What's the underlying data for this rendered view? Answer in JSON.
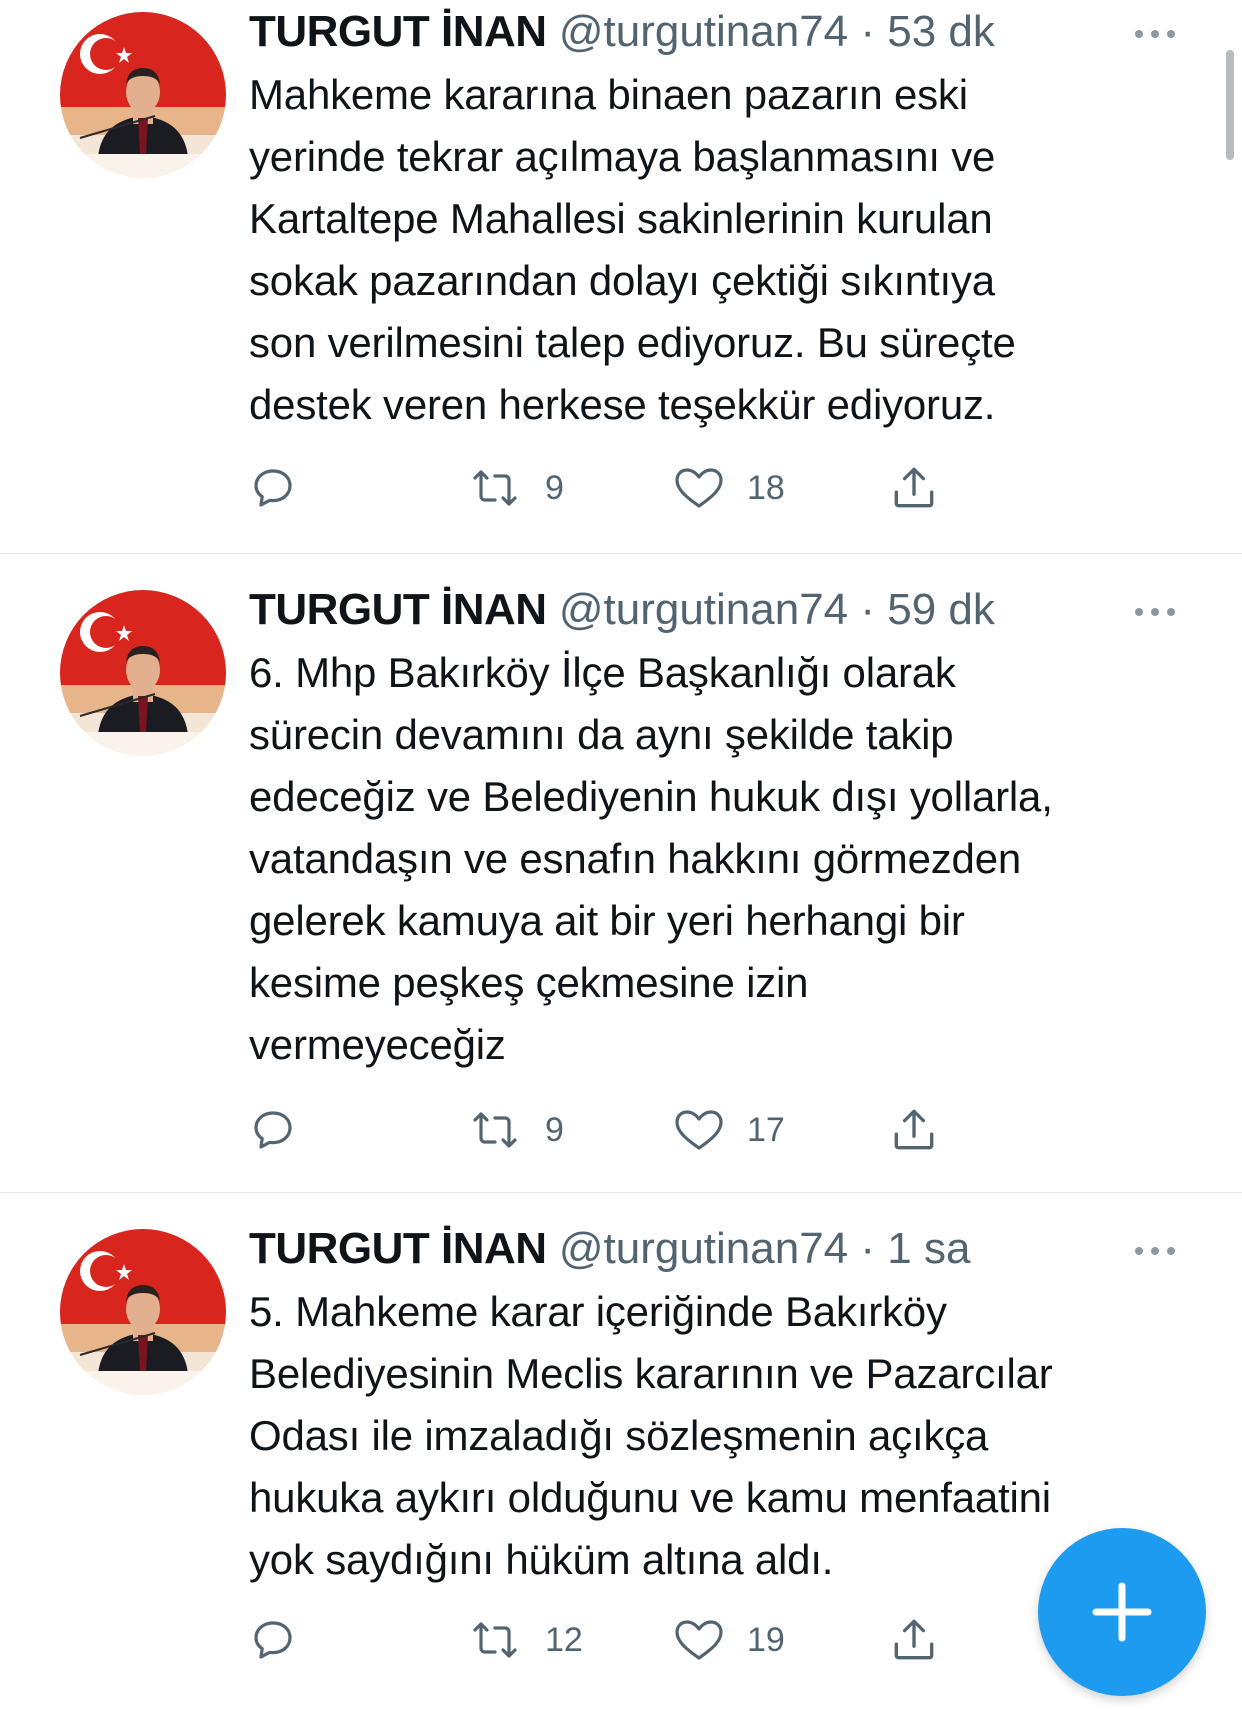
{
  "colors": {
    "text": "#0f1419",
    "secondary": "#536471",
    "divider": "#e6e9ec",
    "fab": "#1d9bf0"
  },
  "tweets": [
    {
      "author_name": "TURGUT İNAN",
      "handle": "@turgutinan74",
      "separator": "·",
      "time": "53 dk",
      "text": "Mahkeme kararına binaen pazarın eski\nyerinde tekrar açılmaya başlanmasını ve\nKartaltepe Mahallesi sakinlerinin kurulan\nsokak pazarından dolayı çektiği sıkıntıya\nson verilmesini talep ediyoruz. Bu süreçte\ndestek veren herkese teşekkür ediyoruz.",
      "retweets": "9",
      "likes": "18"
    },
    {
      "author_name": "TURGUT İNAN",
      "handle": "@turgutinan74",
      "separator": "·",
      "time": "59 dk",
      "text": "6. Mhp Bakırköy İlçe Başkanlığı olarak\nsürecin devamını da aynı şekilde takip\nedeceğiz ve Belediyenin hukuk dışı yollarla,\nvatandaşın ve esnafın hakkını görmezden\ngelerek kamuya ait bir yeri herhangi bir\nkesime peşkeş çekmesine izin\nvermeyeceğiz",
      "retweets": "9",
      "likes": "17"
    },
    {
      "author_name": "TURGUT İNAN",
      "handle": "@turgutinan74",
      "separator": "·",
      "time": "1 sa",
      "text": "5. Mahkeme karar içeriğinde Bakırköy\nBelediyesinin Meclis kararının ve Pazarcılar\nOdası ile imzaladığı sözleşmenin açıkça\nhukuka aykırı olduğunu ve kamu menfaatini\nyok saydığını hüküm altına aldı.",
      "retweets": "12",
      "likes": "19"
    }
  ],
  "icons": {
    "avatar": "profile-photo",
    "more": "more-horizontal-icon",
    "reply": "reply-bubble-icon",
    "retweet": "retweet-icon",
    "like": "heart-icon",
    "share": "share-upload-icon",
    "compose": "plus-icon"
  }
}
